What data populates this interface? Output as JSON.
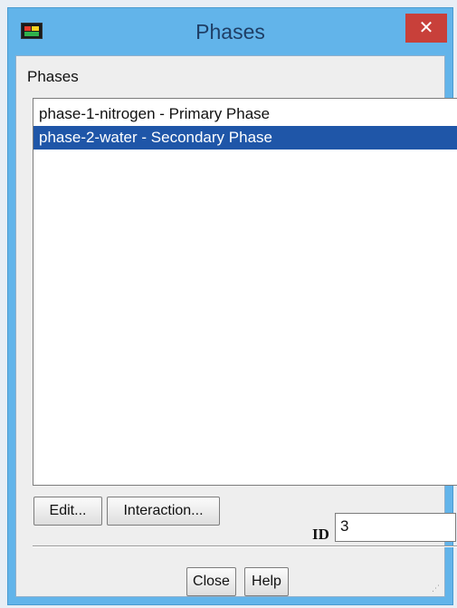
{
  "window": {
    "title": "Phases",
    "close_glyph": "✕",
    "app_icon": "fluent-app-icon"
  },
  "phases_group": {
    "label": "Phases",
    "items": [
      {
        "label": "phase-1-nitrogen - Primary Phase",
        "selected": false
      },
      {
        "label": "phase-2-water - Secondary Phase",
        "selected": true
      }
    ]
  },
  "buttons": {
    "edit": "Edit...",
    "interaction": "Interaction...",
    "close": "Close",
    "help": "Help"
  },
  "id_field": {
    "label": "ID",
    "value": "3"
  },
  "colors": {
    "selection": "#1f56a8",
    "titlebar": "#62b4ea",
    "close_button": "#c8403a"
  }
}
